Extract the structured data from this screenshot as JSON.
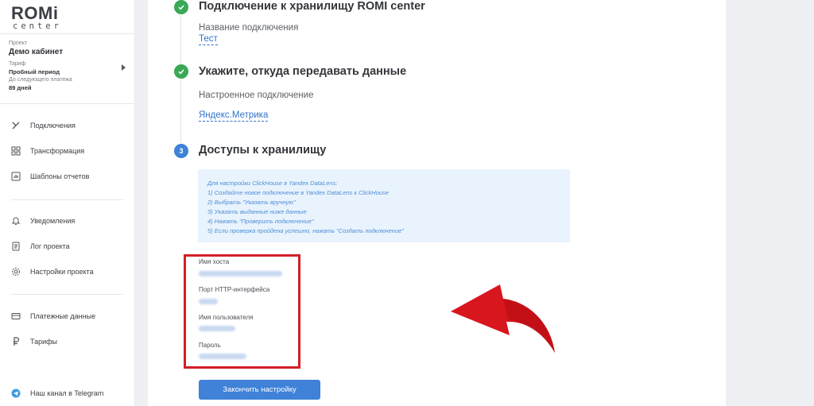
{
  "logo": {
    "brand": "ROMi",
    "sub": "center"
  },
  "project": {
    "label": "Проект",
    "name": "Демо кабинет",
    "tariff_label": "Тариф",
    "tariff_value": "Пробный период",
    "payment_label": "До следующего платежа",
    "payment_value": "89 дней"
  },
  "nav": {
    "connections": "Подключения",
    "transformation": "Трансформация",
    "report_templates": "Шаблоны отчетов",
    "notifications": "Уведомления",
    "project_log": "Лог проекта",
    "project_settings": "Настройки проекта",
    "payment_data": "Платежные данные",
    "tariffs": "Тарифы",
    "telegram": "Наш канал в Telegram"
  },
  "steps": {
    "step1": {
      "title": "Подключение к хранилищу ROMI center",
      "field_label": "Название подключения",
      "field_value": "Тест"
    },
    "step2": {
      "title": "Укажите, откуда передавать данные",
      "field_label": "Настроенное подключение",
      "field_value": "Яндекс.Метрика"
    },
    "step3": {
      "number": "3",
      "title": "Доступы к хранилищу"
    }
  },
  "info_box": {
    "lines": [
      "Для настройки ClickHouse в Yandex DataLens:",
      "1) Создайте новое подключение в Yandex DataLens к ClickHouse",
      "2) Выбрать \"Указать вручную\"",
      "3) Указать выданные ниже данные",
      "4) Нажать \"Проверить подключение\"",
      "5) Если проверка пройдена успешно, нажать \"Создать подключение\""
    ]
  },
  "credentials": {
    "host_label": "Имя хоста",
    "port_label": "Порт HTTP-интерфейса",
    "user_label": "Имя пользователя",
    "password_label": "Пароль"
  },
  "finish_button": "Закончить настройку",
  "colors": {
    "accent": "#3f82d8",
    "success": "#3aa856",
    "highlight": "#d21f26",
    "info_bg": "#e9f3fd"
  }
}
